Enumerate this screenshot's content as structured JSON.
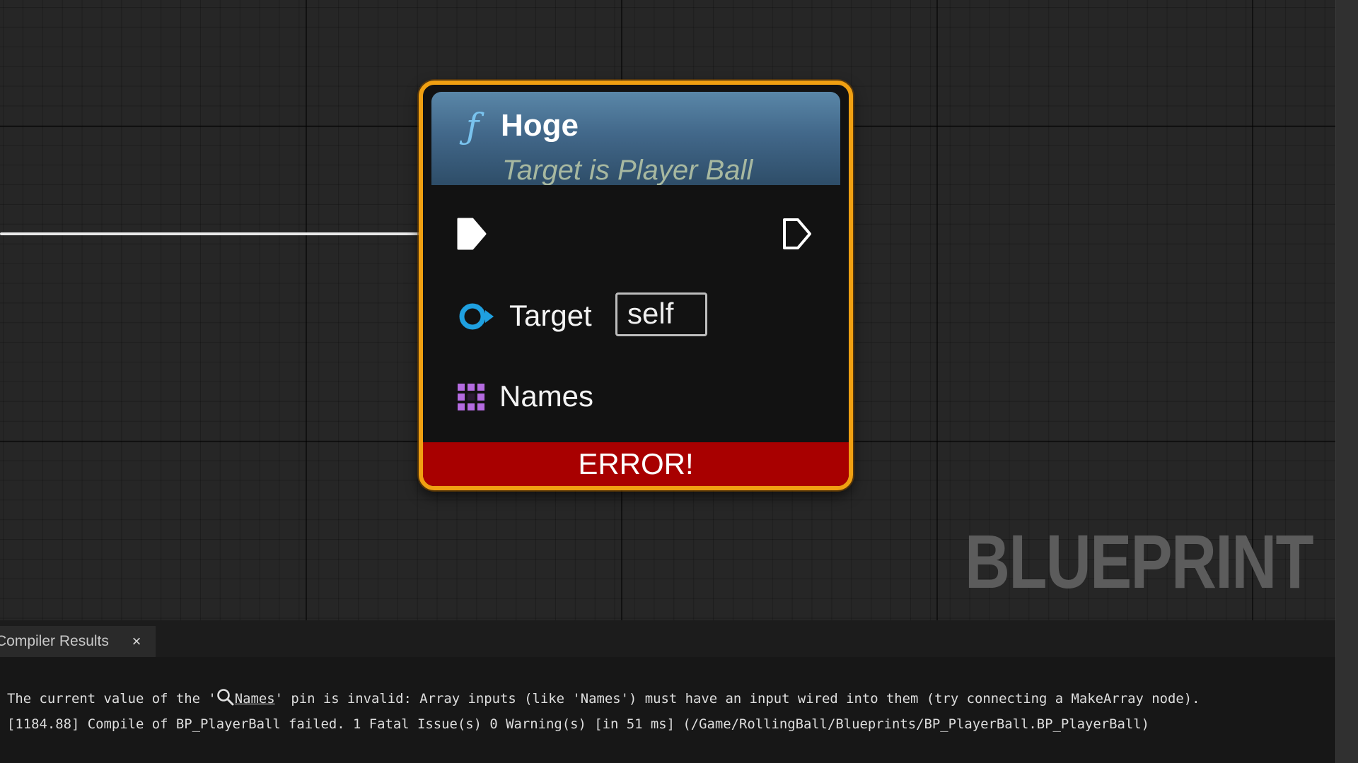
{
  "node": {
    "title": "Hoge",
    "subtitle": "Target is Player Ball",
    "target_label": "Target",
    "target_value": "self",
    "names_label": "Names",
    "error_text": "ERROR!"
  },
  "watermark": "BLUEPRINT",
  "panel": {
    "tab_label": "Compiler Results",
    "close_glyph": "×",
    "message_1_prefix": "The current value of the '",
    "message_1_pin": "Names",
    "message_1_suffix": "' pin is invalid: Array inputs (like 'Names') must have an input wired into them (try connecting a MakeArray node).",
    "message_2": "[1184.88] Compile of BP_PlayerBall failed. 1 Fatal Issue(s) 0 Warning(s) [in 51 ms] (/Game/RollingBall/Blueprints/BP_PlayerBall.BP_PlayerBall)"
  },
  "colors": {
    "node_border": "#f0a012",
    "header_blue": "#4a7396",
    "function_icon": "#79c3ee",
    "object_pin": "#1fa0e0",
    "array_pin": "#b46be0",
    "error_red": "#a80000"
  },
  "icons": {
    "function": "function-icon",
    "exec_in": "exec-pin-filled-icon",
    "exec_out": "exec-pin-outline-icon",
    "object_pin": "object-pin-icon",
    "array_pin": "array-grid-pin-icon",
    "search": "search-icon",
    "close": "close-icon"
  }
}
